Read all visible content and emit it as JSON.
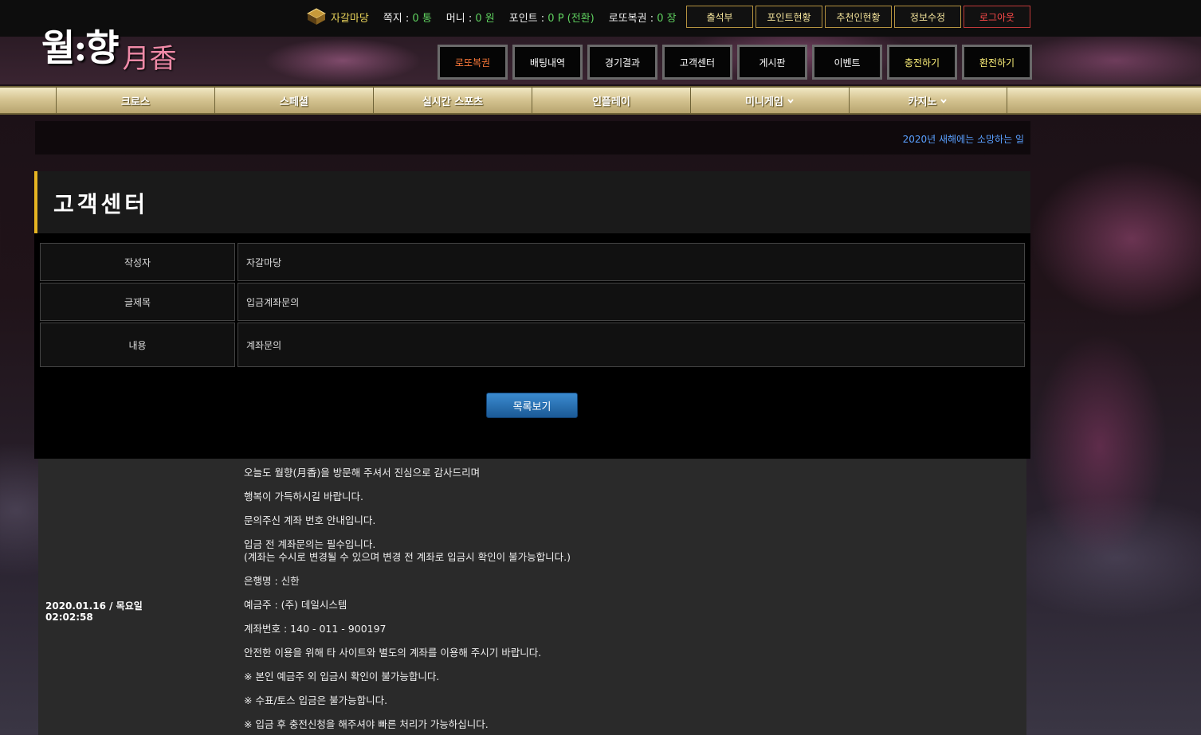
{
  "header": {
    "logo_text": "월:향",
    "logo_hanja": "月香",
    "user": {
      "name": "자갈마당",
      "messages_label": "쪽지 :",
      "messages_value": "0 통",
      "money_label": "머니 :",
      "money_value": "0 원",
      "points_label": "포인트 :",
      "points_value": "0 P (전환)",
      "lotto_label": "로또복권 :",
      "lotto_value": "0 장"
    },
    "top_buttons": [
      "출석부",
      "포인트현황",
      "추천인현황",
      "정보수정",
      "로그아웃"
    ],
    "main_buttons": [
      "로또복권",
      "배팅내역",
      "경기결과",
      "고객센터",
      "게시판",
      "이벤트",
      "충전하기",
      "환전하기"
    ]
  },
  "menu": {
    "items": [
      "크로스",
      "스페셜",
      "실시간 스포츠",
      "인플레이",
      "미니게임",
      "카지노"
    ]
  },
  "ticker": {
    "text": "2020년 새해에는 소망하는 일"
  },
  "page": {
    "title": "고객센터"
  },
  "post": {
    "author_label": "작성자",
    "author_value": "자갈마당",
    "subject_label": "글제목",
    "subject_value": "입금계좌문의",
    "content_label": "내용",
    "content_value": "계좌문의",
    "list_button": "목록보기"
  },
  "reply": {
    "date": "2020.01.16 / 목요일",
    "time": "02:02:58",
    "paragraphs": [
      "오늘도 월향(月香)을 방문해 주셔서 진심으로 감사드리며",
      "행복이 가득하시길 바랍니다.",
      "문의주신 계좌 번호 안내입니다.",
      "입금 전 계좌문의는 필수입니다.\n(계좌는 수시로 변경될 수 있으며 변경 전 계좌로 입금시 확인이 불가능합니다.)",
      "은행명 : 신한",
      "예금주 : (주) 데일시스템",
      "계좌번호 : 140 - 011 - 900197",
      "안전한 이용을 위해 타 사이트와 별도의 계좌를 이용해 주시기 바랍니다.",
      "※ 본인 예금주 외 입금시 확인이 불가능합니다.",
      "※ 수표/토스 입금은 불가능합니다.",
      "※ 입금 후 충전신청을 해주셔야 빠른 처리가 가능하십니다."
    ]
  },
  "colors": {
    "accent_gold": "#e6b422",
    "username": "#e8d35a",
    "stat_value": "#5fd15f",
    "logout": "#ff4a4a",
    "ticker": "#5aa0ff",
    "list_button": "#2a74b6"
  }
}
